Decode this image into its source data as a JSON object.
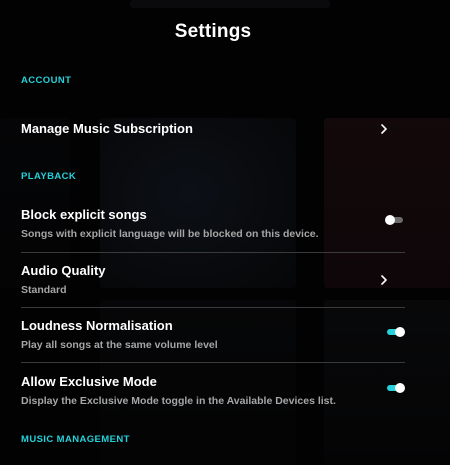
{
  "header": {
    "title": "Settings"
  },
  "sections": {
    "account": "ACCOUNT",
    "playback": "PLAYBACK",
    "music_management": "MUSIC MANAGEMENT"
  },
  "account": {
    "manage_subscription": {
      "title": "Manage Music Subscription",
      "icon": "chevron-right-icon"
    }
  },
  "playback": {
    "block_explicit": {
      "title": "Block explicit songs",
      "subtitle": "Songs with explicit language will be blocked on this device.",
      "enabled": false
    },
    "audio_quality": {
      "title": "Audio Quality",
      "value": "Standard",
      "icon": "chevron-right-icon"
    },
    "loudness_normalisation": {
      "title": "Loudness Normalisation",
      "subtitle": "Play all songs at the same volume level",
      "enabled": true
    },
    "exclusive_mode": {
      "title": "Allow Exclusive Mode",
      "subtitle": "Display the Exclusive Mode toggle in the Available Devices list.",
      "enabled": true
    }
  },
  "colors": {
    "accent": "#25d1da",
    "background": "#050505",
    "text_primary": "#ffffff",
    "text_secondary": "#a6a6a6",
    "toggle_off": "#6b6b6b"
  }
}
